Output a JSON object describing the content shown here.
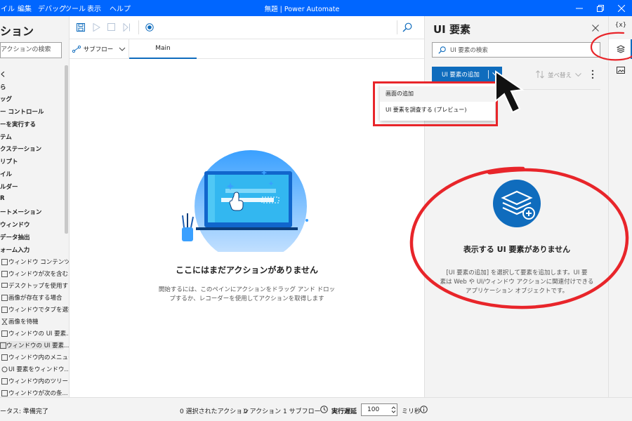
{
  "titlebar": {
    "menus": [
      "イル",
      "編集",
      "デバッグ",
      "ツール",
      "表示",
      "ヘルプ"
    ],
    "title": "無題 | Power Automate"
  },
  "left_panel": {
    "heading": "ション",
    "search_placeholder": "アクションの検索",
    "categories": [
      "く",
      "ら",
      "ッグ",
      "ー コントロール",
      "ーを実行する",
      "テム",
      "クステーション",
      "リプト",
      "イル",
      "ルダー",
      "R",
      "ートメーション",
      "ウィンドウ",
      "データ抽出",
      "ォーム入力"
    ],
    "actions": [
      "ウィンドウ コンテンツ...",
      "ウィンドウが次を含む...",
      "デスクトップを使用する",
      "画像が存在する場合",
      "ウィンドウでタブを選択",
      "画像を待機",
      "ウィンドウの UI 要素...",
      "ウィンドウの UI 要素...",
      "ウィンドウ内のメニュー...",
      "UI 要素をウィンドウ...",
      "ウィンドウ内のツリー...",
      "ウィンドウが次の条..."
    ]
  },
  "center": {
    "subflow_label": "サブフロー",
    "main_tab": "Main",
    "empty_title": "ここにはまだアクションがありません",
    "empty_desc_line1": "開始するには、このペインにアクションをドラッグ アンド ドロッ",
    "empty_desc_line2": "プするか、レコーダーを使用してアクションを取得します"
  },
  "right_panel": {
    "title": "UI 要素",
    "search_placeholder": "UI 要素の検索",
    "add_button": "UI 要素の追加",
    "sort_label": "並べ替え",
    "dropdown_items": [
      "画面の追加",
      "UI 要素を調査する (プレビュー)"
    ],
    "empty_title": "表示する UI 要素がありません",
    "empty_desc_line1": "[UI 要素の追加] を選択して要素を追加します。UI 要",
    "empty_desc_line2": "素は Web や UI/ウィンドウ アクションに関連付けできる",
    "empty_desc_line3": "アプリケーション オブジェクトです。"
  },
  "rail": {
    "variables_label": "{x}"
  },
  "statusbar": {
    "status": "ータス: 準備完了",
    "selected_actions": "0 選択されたアクション",
    "actions_count": "0 アクション",
    "subflows_count": "1 サブフロー",
    "delay_label": "実行遅延",
    "delay_value": "100",
    "delay_unit": "ミリ秒"
  },
  "colors": {
    "accent": "#0f6cbd",
    "titlebar": "#0066ff",
    "annotation_red": "#e8252a",
    "illustration_blue": "#3aa0ff"
  }
}
